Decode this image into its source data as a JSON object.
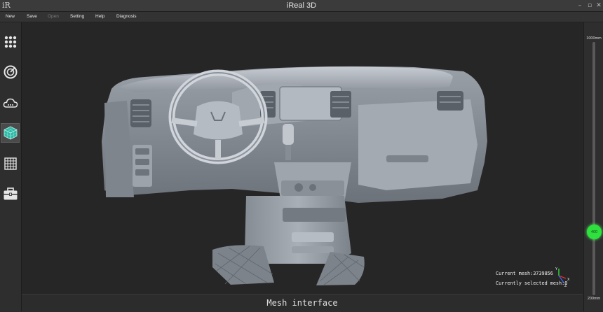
{
  "window": {
    "title": "iReal 3D",
    "logo": "iR",
    "controls": {
      "minimize": "–",
      "maximize": "▫",
      "close": "✕"
    }
  },
  "menu": [
    {
      "label": "New",
      "enabled": true
    },
    {
      "label": "Save",
      "enabled": true
    },
    {
      "label": "Open",
      "enabled": false
    },
    {
      "label": "Setting",
      "enabled": true
    },
    {
      "label": "Help",
      "enabled": true
    },
    {
      "label": "Diagnosis",
      "enabled": true
    }
  ],
  "sidebar": {
    "tools": [
      {
        "name": "dots-grid-icon",
        "active": false
      },
      {
        "name": "radar-scan-icon",
        "active": false
      },
      {
        "name": "cloud-point-icon",
        "active": false
      },
      {
        "name": "mesh-cube-icon",
        "active": true
      },
      {
        "name": "grid-icon",
        "active": false
      },
      {
        "name": "toolbox-icon",
        "active": false
      }
    ]
  },
  "viewport": {
    "object": "car-dashboard-mesh",
    "mesh_info": {
      "current": "Current mesh:3739856",
      "selected": "Currently selected mesh:0"
    },
    "axis_colors": {
      "x": "#ff3030",
      "y": "#30ff40",
      "z": "#3a6bff"
    }
  },
  "status": {
    "text": "Mesh interface"
  },
  "depth_slider": {
    "max_label": "1000mm",
    "min_label": "200mm",
    "value_label": "400",
    "fraction_from_top": 0.75,
    "color": "#2ee23d"
  }
}
